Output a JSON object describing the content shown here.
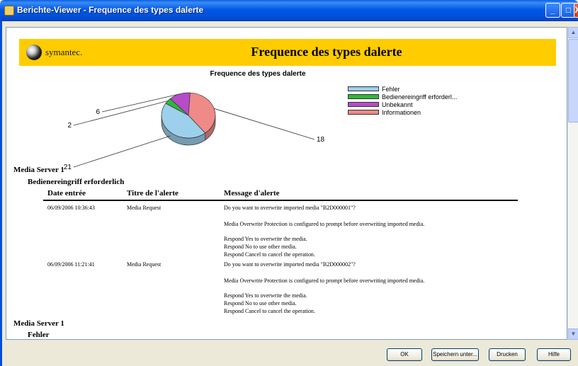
{
  "window": {
    "title": "Berichte-Viewer - Frequence des types dalerte",
    "minimize_glyph": "_",
    "maximize_glyph": "□",
    "close_glyph": "X"
  },
  "scrollbar": {
    "up_glyph": "▲",
    "down_glyph": "▼"
  },
  "report": {
    "logo_text": "symantec.",
    "banner_title": "Frequence des types dalerte",
    "chart_title": "Frequence des types dalerte"
  },
  "chart_data": {
    "type": "pie",
    "title": "Frequence des types dalerte",
    "categories": [
      "Fehler",
      "Bedienereingriff erforderl...",
      "Unbekannt",
      "Informationen"
    ],
    "values": [
      21,
      2,
      6,
      18
    ],
    "colors": [
      "#9cd0ec",
      "#2fb83a",
      "#b64cc8",
      "#ee8a88"
    ],
    "data_labels": [
      "21",
      "2",
      "6",
      "18"
    ],
    "legend_position": "right"
  },
  "sections": [
    {
      "server": "Media Server 1",
      "subsection": "Bedienereingriff erforderlich"
    },
    {
      "server": "Media Server 1",
      "subsection": "Fehler"
    }
  ],
  "table": {
    "headers": [
      "Date entrée",
      "Titre de l'alerte",
      "Message d'alerte"
    ],
    "rows": [
      {
        "date": "06/09/2006 10:36:43",
        "title": "Media Request",
        "message": [
          "Do you want to overwrite imported media \"B2D000001\"?",
          "Media Overwrite Protection is configured to prompt before overwriting imported media.",
          "Respond Yes to overwrite the media.",
          "Respond No to use other media.",
          "Respond Cancel to cancel the operation."
        ]
      },
      {
        "date": "06/09/2006 11:21:41",
        "title": "Media Request",
        "message": [
          "Do you want to overwrite imported media \"B2D000002\"?",
          "Media Overwrite Protection is configured to prompt before overwriting imported media.",
          "Respond Yes to overwrite the media.",
          "Respond No to use other media.",
          "Respond Cancel to cancel the operation."
        ]
      }
    ]
  },
  "buttons": {
    "ok": "OK",
    "save_as": "Speichern unter...",
    "print": "Drucken",
    "help": "Hilfe"
  }
}
